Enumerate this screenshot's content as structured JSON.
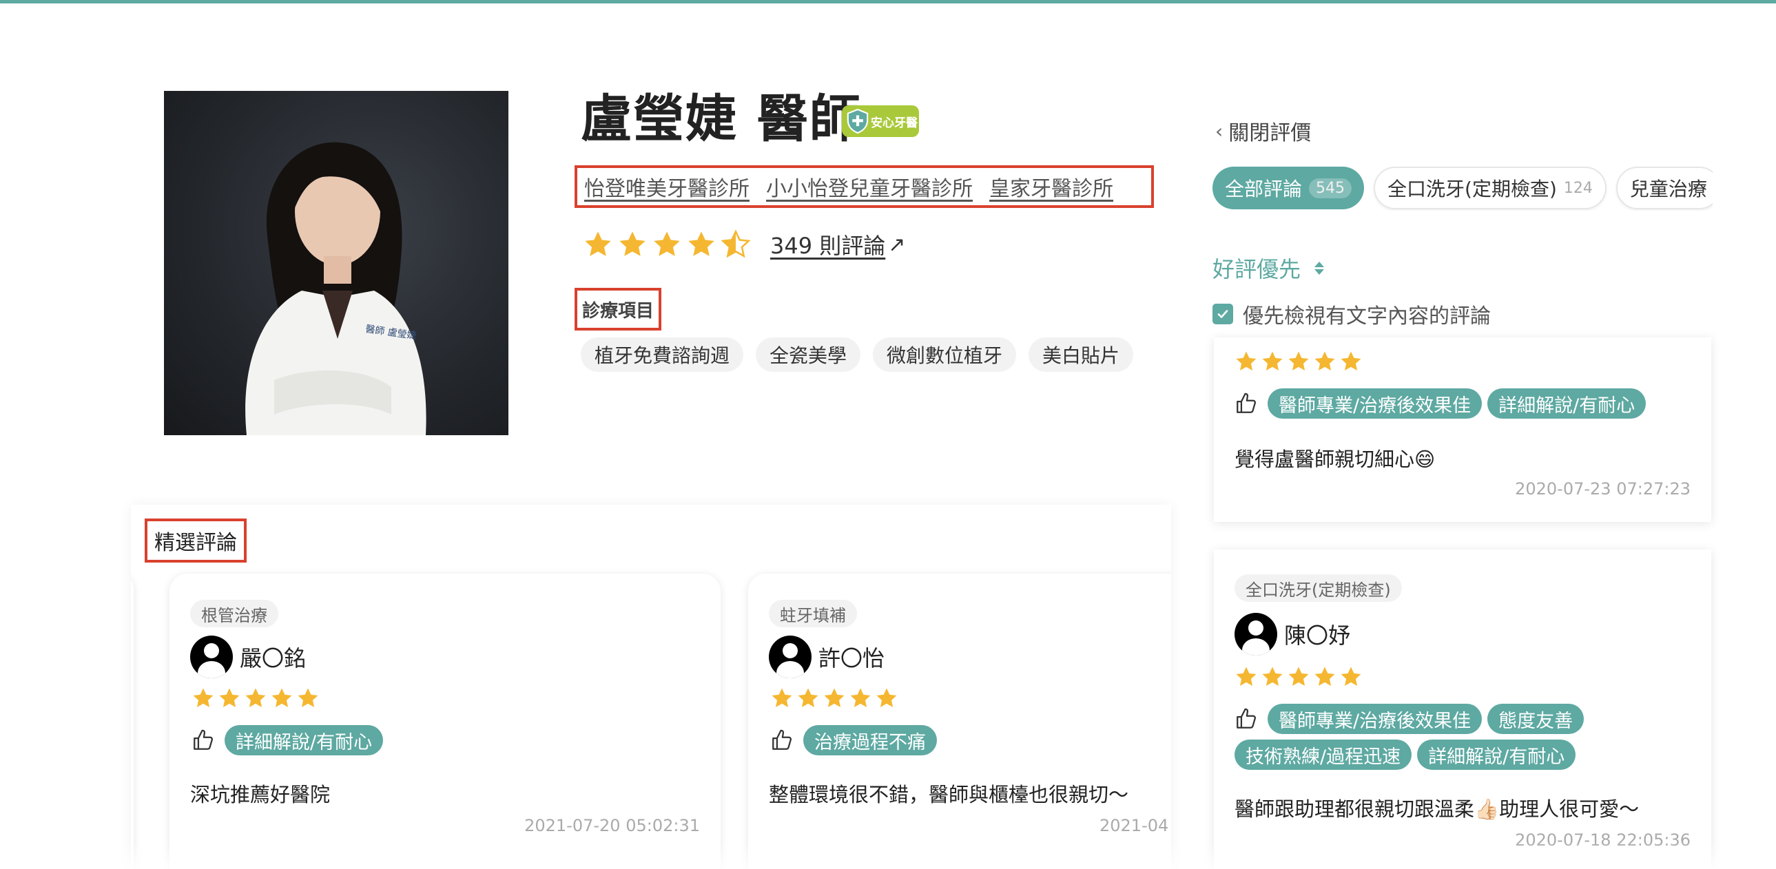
{
  "colors": {
    "accent": "#5ea9a2",
    "highlight_box": "#d9412e",
    "star": "#f5b731",
    "badge": "#a9c93a"
  },
  "doctor": {
    "name": "盧瑩婕 醫師",
    "badge_label": "安心牙醫",
    "clinics": [
      "怡登唯美牙醫診所",
      "小小怡登兒童牙醫診所",
      "皇家牙醫診所"
    ],
    "rating": 4.5,
    "reviews_link": "349 則評論",
    "photo_label": "醫師 盧瑩婕"
  },
  "services": {
    "label": "診療項目",
    "items": [
      "植牙免費諮詢週",
      "全瓷美學",
      "微創數位植牙",
      "美白貼片"
    ]
  },
  "featured": {
    "label": "精選評論",
    "cards": [
      {
        "category": "根管治療",
        "user": "嚴〇銘",
        "rating": 5,
        "tags": [
          "詳細解說/有耐心"
        ],
        "text": "深坑推薦好醫院",
        "date": "2021-07-20 05:02:31"
      },
      {
        "category": "蛀牙填補",
        "user": "許〇怡",
        "rating": 5,
        "tags": [
          "治療過程不痛"
        ],
        "text": "整體環境很不錯，醫師與櫃檯也很親切～",
        "date": "2021-04"
      }
    ]
  },
  "review_panel": {
    "close_label": "關閉評價",
    "filters": [
      {
        "label": "全部評論",
        "count": "545",
        "active": true
      },
      {
        "label": "全口洗牙(定期檢查)",
        "count": "124",
        "active": false
      },
      {
        "label": "兒童治療",
        "count": "",
        "active": false
      }
    ],
    "sort_label": "好評優先",
    "prefer_text_label": "優先檢視有文字內容的評論",
    "prefer_text_checked": true,
    "reviews": [
      {
        "rating": 5,
        "tags": [
          "醫師專業/治療後效果佳",
          "詳細解說/有耐心"
        ],
        "text": "覺得盧醫師親切細心😄",
        "date": "2020-07-23 07:27:23"
      },
      {
        "category": "全口洗牙(定期檢查)",
        "user": "陳〇妤",
        "rating": 5,
        "tags": [
          "醫師專業/治療後效果佳",
          "態度友善",
          "技術熟練/過程迅速",
          "詳細解說/有耐心"
        ],
        "text": "醫師跟助理都很親切跟溫柔👍🏻助理人很可愛～",
        "date": "2020-07-18 22:05:36"
      }
    ]
  }
}
